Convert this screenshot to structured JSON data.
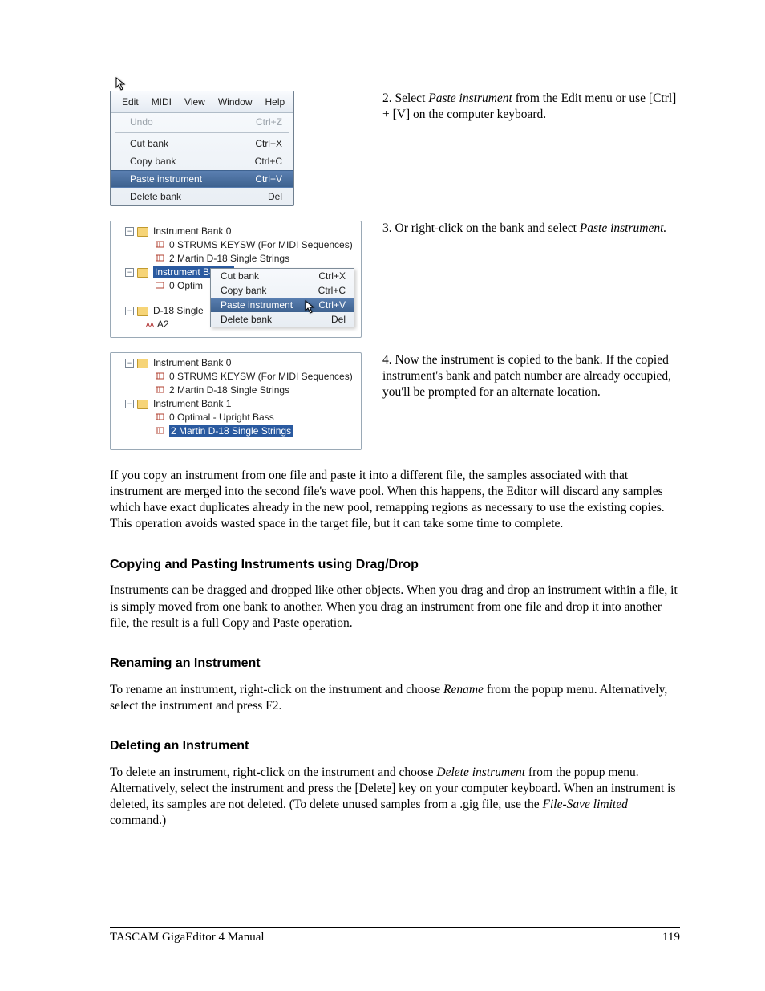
{
  "menus": {
    "bar": [
      "Edit",
      "MIDI",
      "View",
      "Window",
      "Help"
    ],
    "items": [
      {
        "label": "Undo",
        "shortcut": "Ctrl+Z",
        "disabled": true
      },
      {
        "sep": true
      },
      {
        "label": "Cut bank",
        "shortcut": "Ctrl+X"
      },
      {
        "label": "Copy bank",
        "shortcut": "Ctrl+C"
      },
      {
        "label": "Paste instrument",
        "shortcut": "Ctrl+V",
        "highlight": true
      },
      {
        "label": "Delete bank",
        "shortcut": "Del"
      }
    ]
  },
  "step2": "2. Select <em>Paste instrument</em> from the Edit menu or use [Ctrl] + [V] on the computer keyboard.",
  "step3": "3. Or right-click on the bank and select <em>Paste instrument.</em>",
  "step4": "4. Now the instrument is copied to the bank.  If the copied instrument's bank and patch number are already occupied, you'll be prompted for an alternate location.",
  "tree1": {
    "bank0": "Instrument Bank 0",
    "bank0_items": [
      "0 STRUMS KEYSW (For MIDI Sequences)",
      "2 Martin D-18 Single Strings"
    ],
    "bank1": "Instrument Bank 1",
    "bank1_items_trunc": "0 Optim",
    "d18": "D-18 Single",
    "a2": "A2"
  },
  "ctx": [
    {
      "label": "Cut bank",
      "shortcut": "Ctrl+X"
    },
    {
      "label": "Copy bank",
      "shortcut": "Ctrl+C"
    },
    {
      "label": "Paste instrument",
      "shortcut": "Ctrl+V",
      "highlight": true
    },
    {
      "label": "Delete bank",
      "shortcut": "Del"
    }
  ],
  "tree2": {
    "bank0": "Instrument Bank 0",
    "bank0_items": [
      "0 STRUMS KEYSW (For MIDI Sequences)",
      "2 Martin D-18 Single Strings"
    ],
    "bank1": "Instrument Bank 1",
    "bank1_items": [
      "0 Optimal - Upright Bass",
      "2 Martin D-18 Single Strings"
    ]
  },
  "para_merge": "If you copy an instrument from one file and paste it into a different file, the samples associated with that instrument are merged into the second file's wave pool.  When this happens, the Editor will discard any samples which have exact duplicates already in the new pool, remapping regions as necessary to use the existing copies.  This operation avoids wasted space in the target file, but it can take some time to complete.",
  "h_dragdrop": "Copying and Pasting Instruments using Drag/Drop",
  "para_dragdrop": "Instruments can be dragged and dropped like other objects.  When you drag and drop an instrument within a file, it is simply moved from one bank to another.  When you drag an instrument from one file and drop it into another file, the result is a full Copy and Paste operation.",
  "h_rename": "Renaming an Instrument",
  "para_rename": "To rename an instrument, right-click on the instrument and choose <em>Rename</em> from the popup menu.  Alternatively, select the instrument and press F2.",
  "h_delete": "Deleting an Instrument",
  "para_delete": "To delete an instrument, right-click on the instrument and choose <em>Delete instrument</em> from the popup menu.  Alternatively, select the instrument and press the [Delete] key on your computer keyboard.  When an instrument is deleted, its samples are not deleted.  (To delete unused samples from a .gig file, use the <em>File-Save limited</em> command.)",
  "footer_left": "TASCAM GigaEditor 4 Manual",
  "footer_right": "119"
}
